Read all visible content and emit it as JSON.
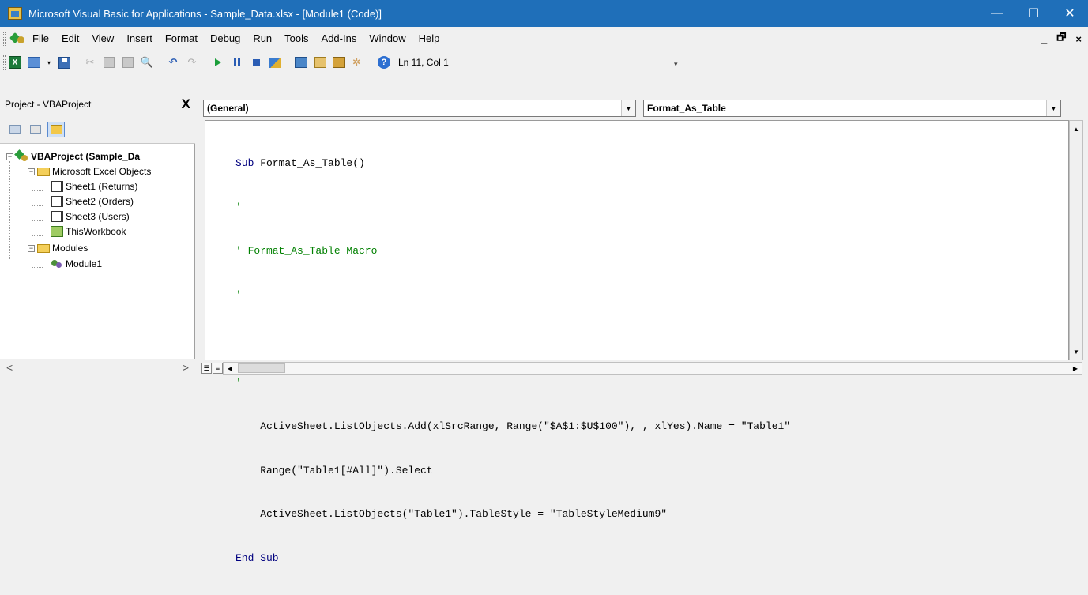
{
  "window": {
    "title": "Microsoft Visual Basic for Applications - Sample_Data.xlsx - [Module1 (Code)]",
    "controls": {
      "minimize": "—",
      "maximize": "☐",
      "close": "✕"
    }
  },
  "menu": {
    "items": [
      "File",
      "Edit",
      "View",
      "Insert",
      "Format",
      "Debug",
      "Run",
      "Tools",
      "Add-Ins",
      "Window",
      "Help"
    ],
    "mdi_controls": {
      "minimize": "_",
      "restore": "🗗",
      "close": "×"
    }
  },
  "toolbar": {
    "position_label": "Ln 11, Col 1",
    "icons": [
      "view-excel-icon",
      "insert-userform-icon",
      "save-icon",
      "cut-icon",
      "copy-icon",
      "paste-icon",
      "find-icon",
      "undo-icon",
      "redo-icon",
      "run-icon",
      "break-icon",
      "reset-icon",
      "design-mode-icon",
      "project-explorer-icon",
      "properties-icon",
      "object-browser-icon",
      "toolbox-icon",
      "help-icon"
    ]
  },
  "project": {
    "title": "Project - VBAProject",
    "close_label": "X",
    "tree": {
      "root": "VBAProject (Sample_Da",
      "excel_objects_folder": "Microsoft Excel Objects",
      "sheets": [
        "Sheet1 (Returns)",
        "Sheet2 (Orders)",
        "Sheet3 (Users)",
        "ThisWorkbook"
      ],
      "modules_folder": "Modules",
      "modules": [
        "Module1"
      ]
    },
    "scroll": {
      "left": "<",
      "right": ">"
    }
  },
  "code": {
    "object_combo": "(General)",
    "procedure_combo": "Format_As_Table",
    "lines": {
      "l1_kw": "Sub",
      "l1_rest": " Format_As_Table()",
      "l2": "'",
      "l3": "' Format_As_Table Macro",
      "l4": "'",
      "l5": "",
      "l6": "'",
      "l7": "    ActiveSheet.ListObjects.Add(xlSrcRange, Range(\"$A$1:$U$100\"), , xlYes).Name = \"Table1\"",
      "l8": "    Range(\"Table1[#All]\").Select",
      "l9": "    ActiveSheet.ListObjects(\"Table1\").TableStyle = \"TableStyleMedium9\"",
      "l10_kw": "End Sub"
    }
  }
}
